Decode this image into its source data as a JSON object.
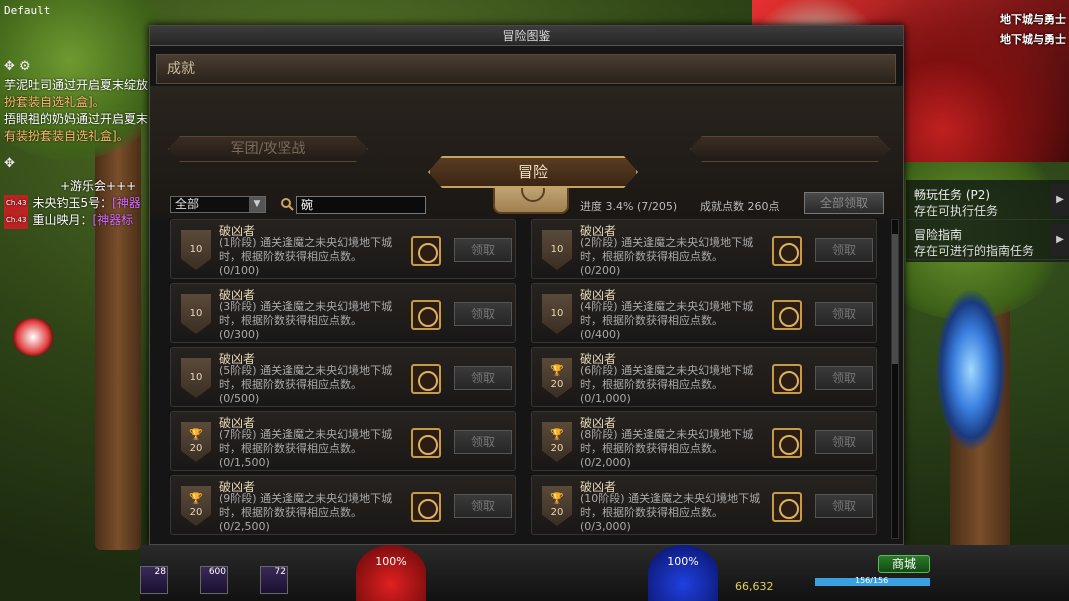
{
  "screen_label": "Default",
  "chat": {
    "lines": [
      {
        "text": "芋泥吐司通过开启夏末绽放",
        "color": "white"
      },
      {
        "text": "扮套装自选礼盒]。",
        "color": "orange"
      },
      {
        "text": "捂眼祖的奶妈通过开启夏末",
        "color": "white"
      },
      {
        "text": "有装扮套装自选礼盒]。",
        "color": "orange"
      }
    ],
    "guild_header": "+游乐会+++",
    "members": [
      {
        "level": "Ch.43",
        "name": "未央钓玉5号：",
        "suffix": "[神器"
      },
      {
        "level": "Ch.43",
        "name": "重山映月：",
        "suffix": "[神器标"
      }
    ]
  },
  "panel": {
    "title": "冒险图鉴",
    "section_title": "成就",
    "tabs": {
      "left": "军团/攻坚战",
      "center": "冒险",
      "right": ""
    },
    "filter": {
      "category": "全部",
      "search_value": "碗",
      "progress_label": "进度",
      "progress_value": "3.4% (7/205)",
      "points_label": "成就点数",
      "points_value": "260点",
      "claim_all": "全部领取"
    },
    "cards": [
      {
        "name": "破凶者",
        "stage": "(1阶段)",
        "desc": "通关逢魔之未央幻境地下城时，根据阶数获得相应点数。",
        "progress": "(0/100)",
        "badge": "10",
        "trophy": false,
        "claim": "领取"
      },
      {
        "name": "破凶者",
        "stage": "(2阶段)",
        "desc": "通关逢魔之未央幻境地下城时，根据阶数获得相应点数。",
        "progress": "(0/200)",
        "badge": "10",
        "trophy": false,
        "claim": "领取"
      },
      {
        "name": "破凶者",
        "stage": "(3阶段)",
        "desc": "通关逢魔之未央幻境地下城时，根据阶数获得相应点数。",
        "progress": "(0/300)",
        "badge": "10",
        "trophy": false,
        "claim": "领取"
      },
      {
        "name": "破凶者",
        "stage": "(4阶段)",
        "desc": "通关逢魔之未央幻境地下城时，根据阶数获得相应点数。",
        "progress": "(0/400)",
        "badge": "10",
        "trophy": false,
        "claim": "领取"
      },
      {
        "name": "破凶者",
        "stage": "(5阶段)",
        "desc": "通关逢魔之未央幻境地下城时，根据阶数获得相应点数。",
        "progress": "(0/500)",
        "badge": "10",
        "trophy": false,
        "claim": "领取"
      },
      {
        "name": "破凶者",
        "stage": "(6阶段)",
        "desc": "通关逢魔之未央幻境地下城时，根据阶数获得相应点数。",
        "progress": "(0/1,000)",
        "badge": "20",
        "trophy": true,
        "claim": "领取"
      },
      {
        "name": "破凶者",
        "stage": "(7阶段)",
        "desc": "通关逢魔之未央幻境地下城时，根据阶数获得相应点数。",
        "progress": "(0/1,500)",
        "badge": "20",
        "trophy": true,
        "claim": "领取"
      },
      {
        "name": "破凶者",
        "stage": "(8阶段)",
        "desc": "通关逢魔之未央幻境地下城时，根据阶数获得相应点数。",
        "progress": "(0/2,000)",
        "badge": "20",
        "trophy": true,
        "claim": "领取"
      },
      {
        "name": "破凶者",
        "stage": "(9阶段)",
        "desc": "通关逢魔之未央幻境地下城时，根据阶数获得相应点数。",
        "progress": "(0/2,500)",
        "badge": "20",
        "trophy": true,
        "claim": "领取"
      },
      {
        "name": "破凶者",
        "stage": "(10阶段)",
        "desc": "通关逢魔之未央幻境地下城时，根据阶数获得相应点数。",
        "progress": "(0/3,000)",
        "badge": "20",
        "trophy": true,
        "claim": "领取"
      }
    ]
  },
  "logo_text": [
    "地下城与勇士",
    "地下城与勇士"
  ],
  "quests": [
    {
      "title": "畅玩任务 (P2)",
      "subtitle": "存在可执行任务"
    },
    {
      "title": "冒险指南",
      "subtitle": "存在可进行的指南任务"
    }
  ],
  "hud": {
    "hp_percent": "100%",
    "mp_percent": "100%",
    "skills": [
      {
        "count": "28"
      },
      {
        "count": "600"
      },
      {
        "count": "72"
      }
    ],
    "gold": "66,632",
    "hp_fraction": "156/156",
    "hp_fill": 1.0,
    "shop_label": "商城"
  },
  "colors": {
    "panel_bg": "#151515",
    "accent_gold": "#c8a060",
    "chat_orange": "#ffb870",
    "chat_purple": "#d66aff",
    "shop_green": "#2a7a2a"
  }
}
